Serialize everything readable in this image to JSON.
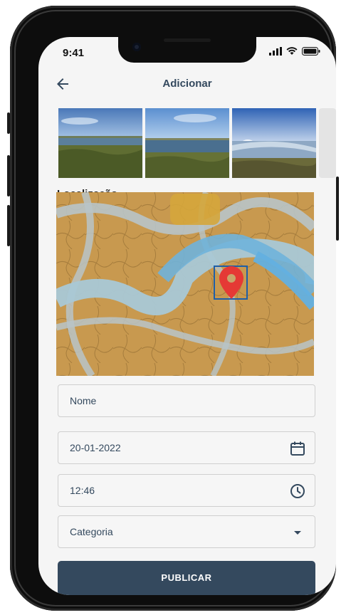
{
  "status_bar": {
    "time": "9:41"
  },
  "app_bar": {
    "title": "Adicionar"
  },
  "section": {
    "location_label": "Localização"
  },
  "form": {
    "name_placeholder": "Nome",
    "date_value": "20-01-2022",
    "time_value": "12:46",
    "category_placeholder": "Categoria"
  },
  "actions": {
    "publish_label": "PUBLICAR"
  },
  "colors": {
    "primary": "#34495e",
    "marker": "#e53935",
    "background": "#f5f5f5"
  },
  "icons": [
    "back-arrow-icon",
    "calendar-icon",
    "clock-icon",
    "dropdown-arrow-icon",
    "map-marker-icon",
    "signal-icon",
    "wifi-icon",
    "battery-icon"
  ]
}
